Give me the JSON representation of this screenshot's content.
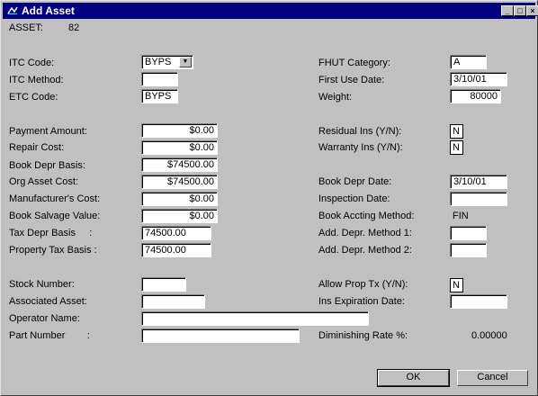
{
  "window": {
    "title": "Add Asset",
    "minimize": "_",
    "maximize": "□",
    "close": "×"
  },
  "asset": {
    "label": "ASSET:",
    "value": "82"
  },
  "left": {
    "itc_code": {
      "label": "ITC Code:",
      "value": "BYPS",
      "arrow": "▼"
    },
    "itc_method": {
      "label": "ITC Method:",
      "value": ""
    },
    "etc_code": {
      "label": "ETC Code:",
      "value": "BYPS"
    },
    "payment_amount": {
      "label": "Payment Amount:",
      "value": "$0.00"
    },
    "repair_cost": {
      "label": "Repair Cost:",
      "value": "$0.00"
    },
    "book_depr_basis": {
      "label": "Book Depr Basis:",
      "value": "$74500.00"
    },
    "org_asset_cost": {
      "label": "Org Asset Cost:",
      "value": "$74500.00"
    },
    "manufacturers_cost": {
      "label": "Manufacturer's Cost:",
      "value": "$0.00"
    },
    "book_salvage_value": {
      "label": "Book Salvage Value:",
      "value": "$0.00"
    },
    "tax_depr_basis": {
      "label": "Tax Depr Basis     :",
      "value": "74500.00"
    },
    "property_tax_basis": {
      "label": "Property Tax Basis :",
      "value": "74500.00"
    },
    "stock_number": {
      "label": "Stock Number:",
      "value": ""
    },
    "associated_asset": {
      "label": "Associated Asset:",
      "value": ""
    },
    "operator_name": {
      "label": "Operator Name:",
      "value": ""
    },
    "part_number": {
      "label": "Part Number        :",
      "value": ""
    }
  },
  "right": {
    "fhut_category": {
      "label": "FHUT Category:",
      "value": "A"
    },
    "first_use_date": {
      "label": "First Use Date:",
      "value": "3/10/01"
    },
    "weight": {
      "label": "Weight:",
      "value": "80000"
    },
    "residual_ins": {
      "label": "Residual Ins (Y/N):",
      "value": "N"
    },
    "warranty_ins": {
      "label": "Warranty Ins (Y/N):",
      "value": "N"
    },
    "book_depr_date": {
      "label": "Book Depr Date:",
      "value": "3/10/01"
    },
    "inspection_date": {
      "label": "Inspection Date:",
      "value": ""
    },
    "book_accting_method": {
      "label": "Book Accting Method:",
      "value": "FIN"
    },
    "add_depr_method_1": {
      "label": "Add. Depr. Method 1:",
      "value": ""
    },
    "add_depr_method_2": {
      "label": "Add. Depr. Method 2:",
      "value": ""
    },
    "allow_prop_tx": {
      "label": "Allow Prop Tx (Y/N):",
      "value": "N"
    },
    "ins_expiration_date": {
      "label": "Ins Expiration Date:",
      "value": ""
    },
    "diminishing_rate": {
      "label": "Diminishing Rate %:",
      "value": "0.00000"
    }
  },
  "buttons": {
    "ok": "OK",
    "cancel": "Cancel"
  }
}
